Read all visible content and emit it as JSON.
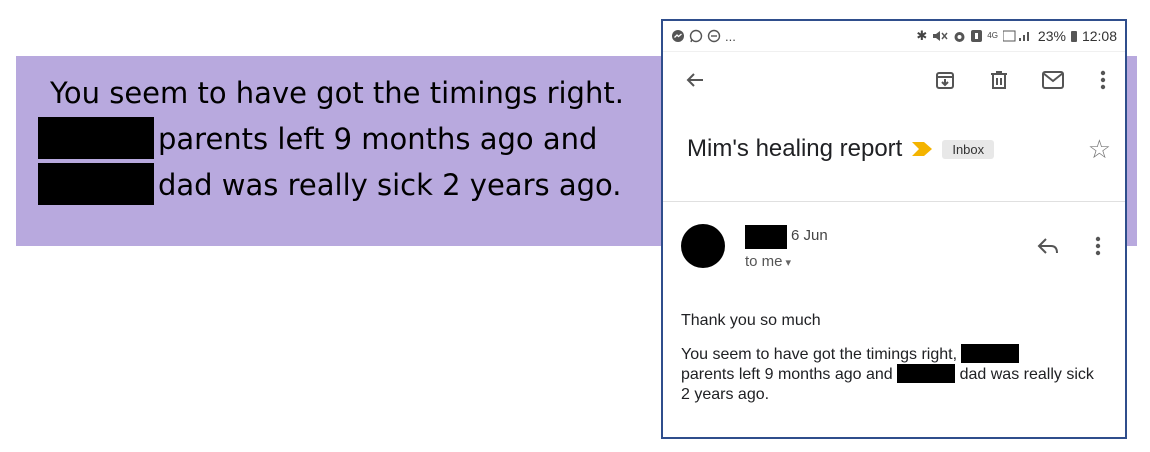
{
  "quote": {
    "line1": "You seem to have got the timings right.",
    "line2": "parents left 9 months ago and",
    "line3": "dad was really sick 2 years ago."
  },
  "status_bar": {
    "left_icons": [
      "messenger-icon",
      "whatsapp-icon",
      "do-not-disturb-icon"
    ],
    "overflow": "...",
    "right_icons": [
      "bluetooth-icon",
      "mute-icon",
      "alarm-icon",
      "notification-icon",
      "4g-icon",
      "signal-icon"
    ],
    "battery": "23%",
    "time": "12:08"
  },
  "toolbar": {
    "icons": [
      "back-arrow-icon",
      "archive-icon",
      "delete-icon",
      "mail-icon",
      "more-vert-icon"
    ]
  },
  "email": {
    "subject": "Mim's healing report",
    "label": "Inbox",
    "date": "6 Jun",
    "recipient": "to me",
    "greeting": "Thank you so much",
    "body_part1": "You seem to have got the timings right,",
    "body_part2": "parents left 9 months ago and",
    "body_part3": "dad was really sick 2 years ago."
  },
  "colors": {
    "banner": "#b8a9de",
    "phone_border": "#2f4e8c",
    "importance": "#f4b400"
  }
}
